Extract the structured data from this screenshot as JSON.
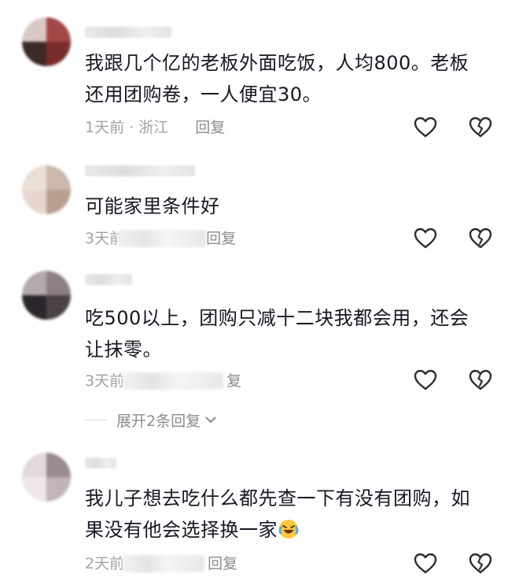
{
  "comments": [
    {
      "text_lines": [
        "我跟几个亿的老板外面吃饭，人均800。老板",
        "还用团购卷，一人便宜30。"
      ],
      "time": "1天前",
      "location": "浙江",
      "reply_label": "回复",
      "avatar_colors": [
        "#c9b8b5",
        "#7a2b2b",
        "#3b2a2a",
        "#a44747"
      ]
    },
    {
      "text_lines": [
        "可能家里条件好"
      ],
      "time": "3天前",
      "reply_label": "回复",
      "avatar_colors": [
        "#eadfd6",
        "#c6b3a5",
        "#e5d7cf",
        "#b89f92"
      ]
    },
    {
      "text_lines": [
        "吃500以上，团购只减十二块我都会用，还会",
        "让抹零。"
      ],
      "time": "3天前",
      "reply_label": "复",
      "avatar_colors": [
        "#a79ca0",
        "#1f1d22",
        "#6f6368",
        "#3c3438"
      ]
    },
    {
      "text_lines": [
        "我儿子想去吃什么都先查一下有没有团购，如",
        "果没有他会选择换一家"
      ],
      "time": "2天前",
      "reply_label": "回复",
      "avatar_colors": [
        "#d9cdcf",
        "#b8a7ab",
        "#eee6e7",
        "#9b8a8f"
      ]
    }
  ],
  "expand_replies": "展开2条回复",
  "icons": {
    "like": "heart-outline-icon",
    "dislike": "broken-heart-icon",
    "expand": "chevron-down-icon",
    "emoji": "laughing-crying-emoji"
  },
  "colors": {
    "text": "#161823",
    "meta": "#a1a2a6",
    "icon": "#2d2e33"
  }
}
